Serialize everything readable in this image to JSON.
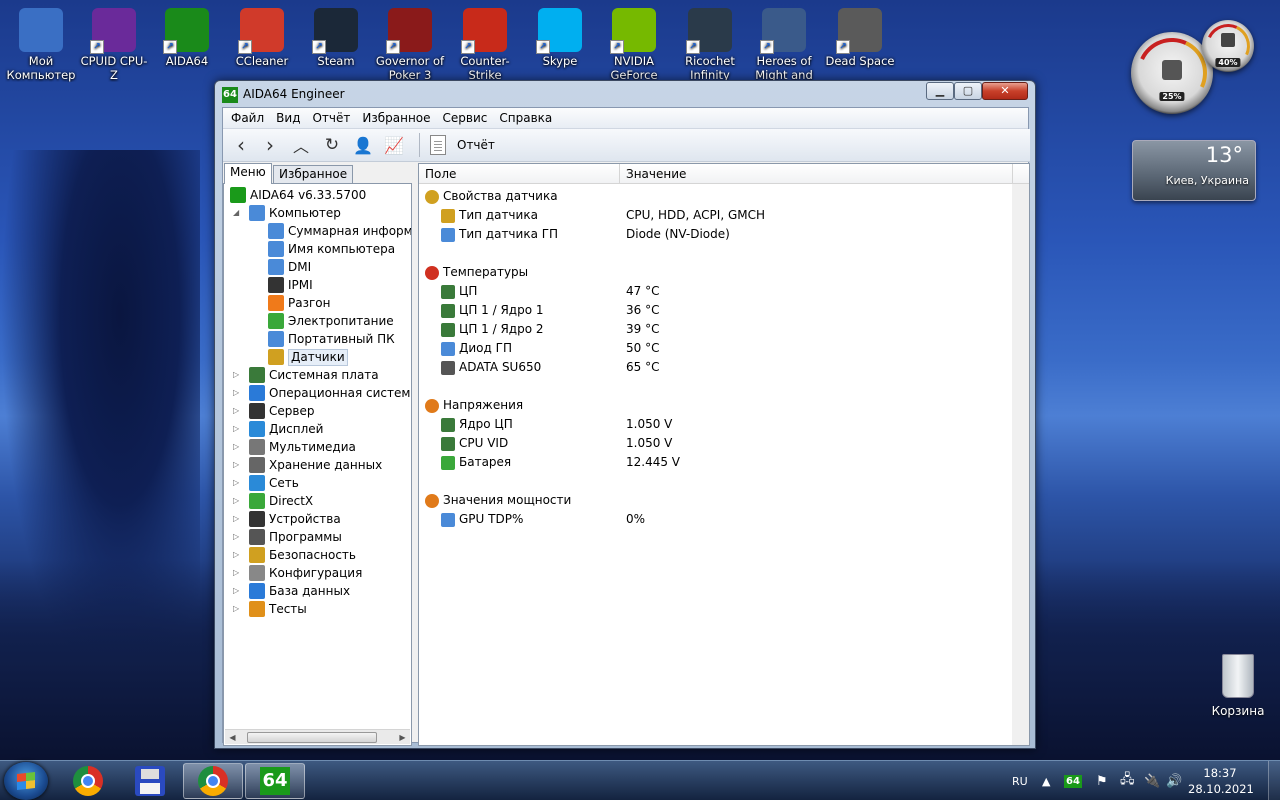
{
  "desktop": {
    "icons": [
      {
        "label": "Мой Компьютер",
        "icon": "computer-icon",
        "color": "#3a6fc4"
      },
      {
        "label": "CPUID CPU-Z",
        "icon": "cpuz-icon",
        "color": "#6a2a9a"
      },
      {
        "label": "AIDA64",
        "icon": "aida64-icon",
        "color": "#1a8a1a"
      },
      {
        "label": "CCleaner",
        "icon": "ccleaner-icon",
        "color": "#d03a2a"
      },
      {
        "label": "Steam",
        "icon": "steam-icon",
        "color": "#1b2838"
      },
      {
        "label": "Governor of Poker 3",
        "icon": "poker-icon",
        "color": "#8a1a1a"
      },
      {
        "label": "Counter-Strike Global Offensive",
        "icon": "csgo-icon",
        "color": "#c82a1a"
      },
      {
        "label": "Skype",
        "icon": "skype-icon",
        "color": "#00aff0"
      },
      {
        "label": "NVIDIA GeForce Experience",
        "icon": "nvidia-icon",
        "color": "#76b900"
      },
      {
        "label": "Ricochet Infinity",
        "icon": "ricochet-icon",
        "color": "#2a3a4a"
      },
      {
        "label": "Heroes of Might and Magic",
        "icon": "heroes-icon",
        "color": "#3a5a8a"
      },
      {
        "label": "Dead Space",
        "icon": "deadspace-icon",
        "color": "#5a5a5a"
      }
    ],
    "gadget_cpu_pct": "25%",
    "gadget_ram_pct": "40%",
    "weather_temp": "13°",
    "weather_city": "Киев, Украина",
    "recycle_label": "Корзина"
  },
  "window": {
    "title": "AIDA64 Engineer",
    "logo": "64",
    "menu": [
      "Файл",
      "Вид",
      "Отчёт",
      "Избранное",
      "Сервис",
      "Справка"
    ],
    "toolbar_title": "Отчёт",
    "tabs": [
      "Меню",
      "Избранное"
    ]
  },
  "tree": {
    "root": "AIDA64 v6.33.5700",
    "computer": "Компьютер",
    "children": [
      {
        "label": "Суммарная информация",
        "icon": "summary-icon",
        "color": "#4a8ad8"
      },
      {
        "label": "Имя компьютера",
        "icon": "computer-name-icon",
        "color": "#4a8ad8"
      },
      {
        "label": "DMI",
        "icon": "dmi-icon",
        "color": "#4a8ad8"
      },
      {
        "label": "IPMI",
        "icon": "ipmi-icon",
        "color": "#333333"
      },
      {
        "label": "Разгон",
        "icon": "flame-icon",
        "color": "#f07a1a"
      },
      {
        "label": "Электропитание",
        "icon": "battery-icon",
        "color": "#3aa83a"
      },
      {
        "label": "Портативный ПК",
        "icon": "laptop-icon",
        "color": "#4a8ad8"
      },
      {
        "label": "Датчики",
        "icon": "sensor-icon",
        "color": "#d0a020"
      }
    ],
    "categories": [
      {
        "label": "Системная плата",
        "icon": "motherboard-icon",
        "color": "#3a7a3a"
      },
      {
        "label": "Операционная система",
        "icon": "windows-icon",
        "color": "#2a7ad8"
      },
      {
        "label": "Сервер",
        "icon": "server-icon",
        "color": "#333333"
      },
      {
        "label": "Дисплей",
        "icon": "display-icon",
        "color": "#2a8ad8"
      },
      {
        "label": "Мультимедиа",
        "icon": "speaker-icon",
        "color": "#777777"
      },
      {
        "label": "Хранение данных",
        "icon": "storage-icon",
        "color": "#666666"
      },
      {
        "label": "Сеть",
        "icon": "network-icon",
        "color": "#2a8ad8"
      },
      {
        "label": "DirectX",
        "icon": "directx-icon",
        "color": "#3aa83a"
      },
      {
        "label": "Устройства",
        "icon": "devices-icon",
        "color": "#333333"
      },
      {
        "label": "Программы",
        "icon": "programs-icon",
        "color": "#555555"
      },
      {
        "label": "Безопасность",
        "icon": "shield-icon",
        "color": "#d0a020"
      },
      {
        "label": "Конфигурация",
        "icon": "config-icon",
        "color": "#888888"
      },
      {
        "label": "База данных",
        "icon": "database-icon",
        "color": "#2a7ad8"
      },
      {
        "label": "Тесты",
        "icon": "tests-icon",
        "color": "#e0901a"
      }
    ]
  },
  "table": {
    "col_field": "Поле",
    "col_value": "Значение",
    "sections": [
      {
        "title": "Свойства датчика",
        "icon": "sensor-icon",
        "color": "#d0a020",
        "rows": [
          {
            "field": "Тип датчика",
            "value": "CPU, HDD, ACPI, GMCH",
            "icon": "sensor-icon",
            "color": "#d0a020"
          },
          {
            "field": "Тип датчика ГП",
            "value": "Diode  (NV-Diode)",
            "icon": "gpu-icon",
            "color": "#4a8ad8"
          }
        ]
      },
      {
        "title": "Температуры",
        "icon": "thermometer-icon",
        "color": "#d03020",
        "rows": [
          {
            "field": "ЦП",
            "value": "47 °C",
            "icon": "cpu-icon",
            "color": "#3a7a3a"
          },
          {
            "field": "ЦП 1 / Ядро 1",
            "value": "36 °C",
            "icon": "cpu-icon",
            "color": "#3a7a3a"
          },
          {
            "field": "ЦП 1 / Ядро 2",
            "value": "39 °C",
            "icon": "cpu-icon",
            "color": "#3a7a3a"
          },
          {
            "field": "Диод ГП",
            "value": "50 °C",
            "icon": "gpu-icon",
            "color": "#4a8ad8"
          },
          {
            "field": "ADATA SU650",
            "value": "65 °C",
            "icon": "disk-icon",
            "color": "#555555"
          }
        ]
      },
      {
        "title": "Напряжения",
        "icon": "voltage-icon",
        "color": "#e07a1a",
        "rows": [
          {
            "field": "Ядро ЦП",
            "value": "1.050 V",
            "icon": "cpu-icon",
            "color": "#3a7a3a"
          },
          {
            "field": "CPU VID",
            "value": "1.050 V",
            "icon": "cpu-icon",
            "color": "#3a7a3a"
          },
          {
            "field": "Батарея",
            "value": "12.445 V",
            "icon": "battery-icon",
            "color": "#3aa83a"
          }
        ]
      },
      {
        "title": "Значения мощности",
        "icon": "voltage-icon",
        "color": "#e07a1a",
        "rows": [
          {
            "field": "GPU TDP%",
            "value": "0%",
            "icon": "gpu-icon",
            "color": "#4a8ad8"
          }
        ]
      }
    ]
  },
  "taskbar": {
    "lang": "RU",
    "time": "18:37",
    "date": "28.10.2021",
    "aida_label": "64"
  }
}
